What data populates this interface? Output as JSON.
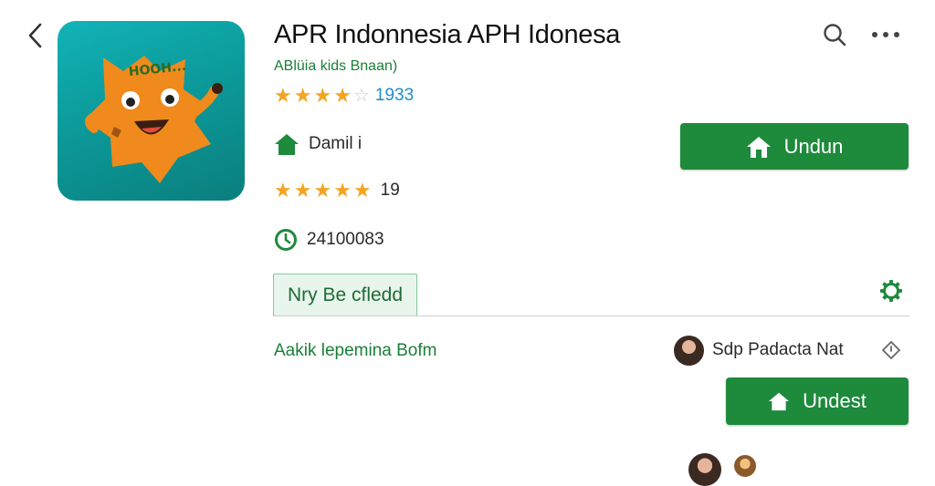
{
  "header": {
    "back_icon": "chevron-left-icon",
    "search_icon": "search-icon",
    "more_icon": "more-horizontal-icon"
  },
  "app": {
    "title": "APR Indonnesia APH Idonesa",
    "developer": "ABlüia kids Bnaan)",
    "icon_text": "HOOH...",
    "rating_stars": 4.5,
    "rating_count": "1933",
    "colors": {
      "accent": "#1e8a3c",
      "star": "#f4a422",
      "icon_bg": "#0c9a9a",
      "mascot": "#f08a1c"
    }
  },
  "meta": {
    "category_icon": "home-icon",
    "category": "Damil i",
    "review_stars": 5,
    "review_value": "19",
    "clock_icon": "clock-icon",
    "downloads": "24100083"
  },
  "install_button": {
    "label": "Undun",
    "icon": "home-icon"
  },
  "tag": {
    "label": "Nry Be cfledd"
  },
  "settings_icon": "gear-icon",
  "section": {
    "link": "Aakik lepemina Bofm",
    "author": "Sdp Padacta Nat",
    "diamond_icon": "diamond-icon"
  },
  "update_button": {
    "label": "Undest",
    "icon": "home-icon"
  }
}
